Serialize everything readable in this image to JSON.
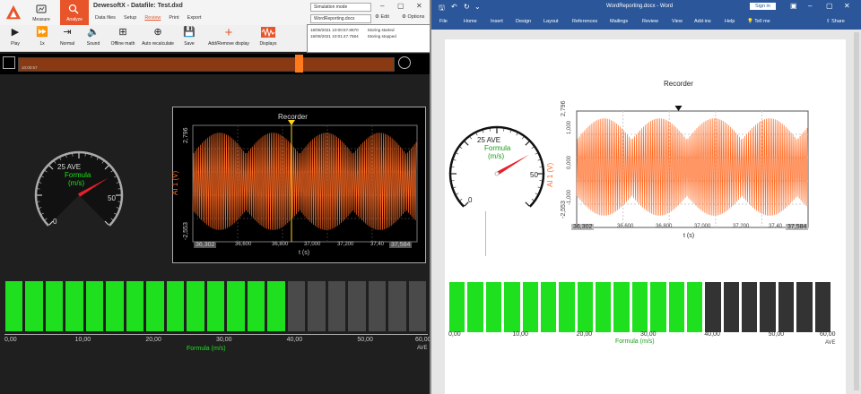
{
  "dewesoft": {
    "app_title": "DewesoftX - Datafile: Test.dxd",
    "modes": [
      {
        "label": "Measure",
        "icon": "measure-icon"
      },
      {
        "label": "Analyze",
        "icon": "analyze-icon"
      }
    ],
    "menu": [
      "Data files",
      "Setup",
      "Review",
      "Print",
      "Export"
    ],
    "active_menu": "Review",
    "sim_mode": "Simulation mode",
    "doc_name": "WordReporting.docx",
    "edit_label": "Edit",
    "options_label": "Options",
    "tools": [
      {
        "label": "Play",
        "icon": "play-icon"
      },
      {
        "label": "1x",
        "icon": "speed-icon"
      },
      {
        "label": "Normal",
        "icon": "normal-icon"
      },
      {
        "label": "Sound",
        "icon": "sound-icon"
      },
      {
        "label": "Offline math",
        "icon": "offline-math-icon"
      },
      {
        "label": "Auto recalculate",
        "icon": "auto-recalculate-icon"
      },
      {
        "label": "Save",
        "icon": "save-icon"
      },
      {
        "label": "Add/Remove display",
        "icon": "add-display-icon"
      },
      {
        "label": "Displays",
        "icon": "displays-icon"
      }
    ],
    "log": [
      {
        "time": "18/08/2021 10:00:57.8670",
        "event": "Storing started"
      },
      {
        "time": "18/08/2021 10:01:47.7584",
        "event": "Storing stopped"
      }
    ],
    "timeline_label": "10:00:57"
  },
  "gauge": {
    "label": "25 AVE",
    "name": "Formula",
    "unit": "(m/s)",
    "tick_0": "0",
    "tick_50": "50",
    "needle_color": "#e8202a",
    "value_fraction": 0.72
  },
  "recorder": {
    "title": "Recorder",
    "ylabel": "AI 1 (V)",
    "y_top": "2,796",
    "y_bottom": "-2,553",
    "y_ticks": [
      "1,000",
      "0,000",
      "-1,000"
    ],
    "x_start": "36,302",
    "x_end": "37,584",
    "x_ticks": [
      "36,600",
      "36,800",
      "37,000",
      "37,200",
      "37,40"
    ],
    "xlabel": "t (s)",
    "signal_color": "#ff6a22"
  },
  "bar_display": {
    "x_ticks": [
      "0,00",
      "10,00",
      "20,00",
      "30,00",
      "40,00",
      "50,00",
      "60,00"
    ],
    "unit_label": "AVE",
    "xlabel": "Formula (m/s)",
    "on_count": 14,
    "total": 21,
    "on_color": "#1fe01f",
    "off_color_dark": "#4a4a4a",
    "off_color_word": "#333333"
  },
  "word": {
    "title": "WordReporting.docx - Word",
    "sign_in": "Sign in",
    "tabs": [
      "File",
      "Home",
      "Insert",
      "Design",
      "Layout",
      "References",
      "Mailings",
      "Review",
      "View",
      "Add-ins",
      "Help",
      "Tell me",
      "Share"
    ],
    "tell_me_icon": "lightbulb-icon",
    "share_icon": "share-icon"
  }
}
